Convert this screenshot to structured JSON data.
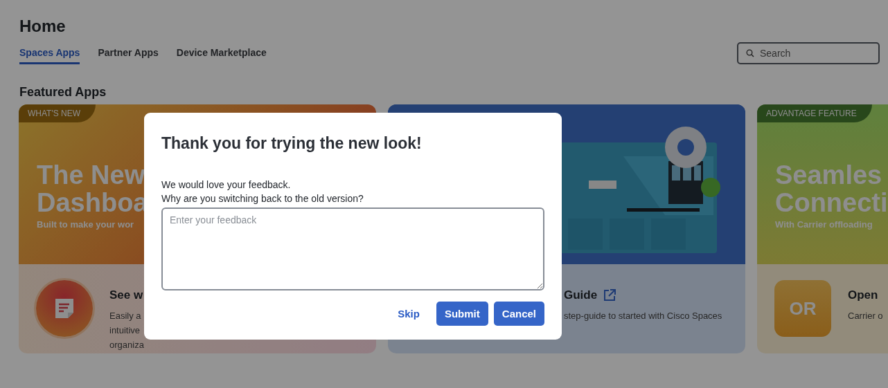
{
  "page": {
    "title": "Home"
  },
  "tabs": [
    {
      "label": "Spaces Apps",
      "selected": true
    },
    {
      "label": "Partner Apps",
      "selected": false
    },
    {
      "label": "Device Marketplace",
      "selected": false
    }
  ],
  "search": {
    "placeholder": "Search"
  },
  "section_title": "Featured Apps",
  "cards": [
    {
      "kind": "headline",
      "badge": "WHAT'S NEW",
      "headline": [
        "The New",
        "Dashboa"
      ],
      "subtitle": "Built to make your wor",
      "logo": {
        "kind": "icon"
      },
      "title": "See w",
      "description": [
        "Easily a",
        "intuitive",
        "organiza"
      ]
    },
    {
      "kind": "picture",
      "title": "Guide",
      "link": true,
      "description": [
        "step-guide to started with Cisco Spaces"
      ]
    },
    {
      "kind": "headline",
      "badge": "ADVANTAGE FEATURE",
      "headline": [
        "Seamles",
        "Connecti"
      ],
      "subtitle": "With Carrier offloading",
      "logo": {
        "kind": "text",
        "text": "OR"
      },
      "title": "Open",
      "description": [
        "Carrier o"
      ]
    }
  ],
  "dialog": {
    "title": "Thank you for trying the new look!",
    "lines": [
      "We would love your feedback.",
      "Why are you switching back to the old version?"
    ],
    "feedback": {
      "placeholder": "Enter your feedback"
    },
    "buttons": [
      {
        "kind": "link",
        "label": "Skip"
      },
      {
        "kind": "primary",
        "label": "Submit"
      },
      {
        "kind": "primary",
        "label": "Cancel"
      }
    ]
  }
}
